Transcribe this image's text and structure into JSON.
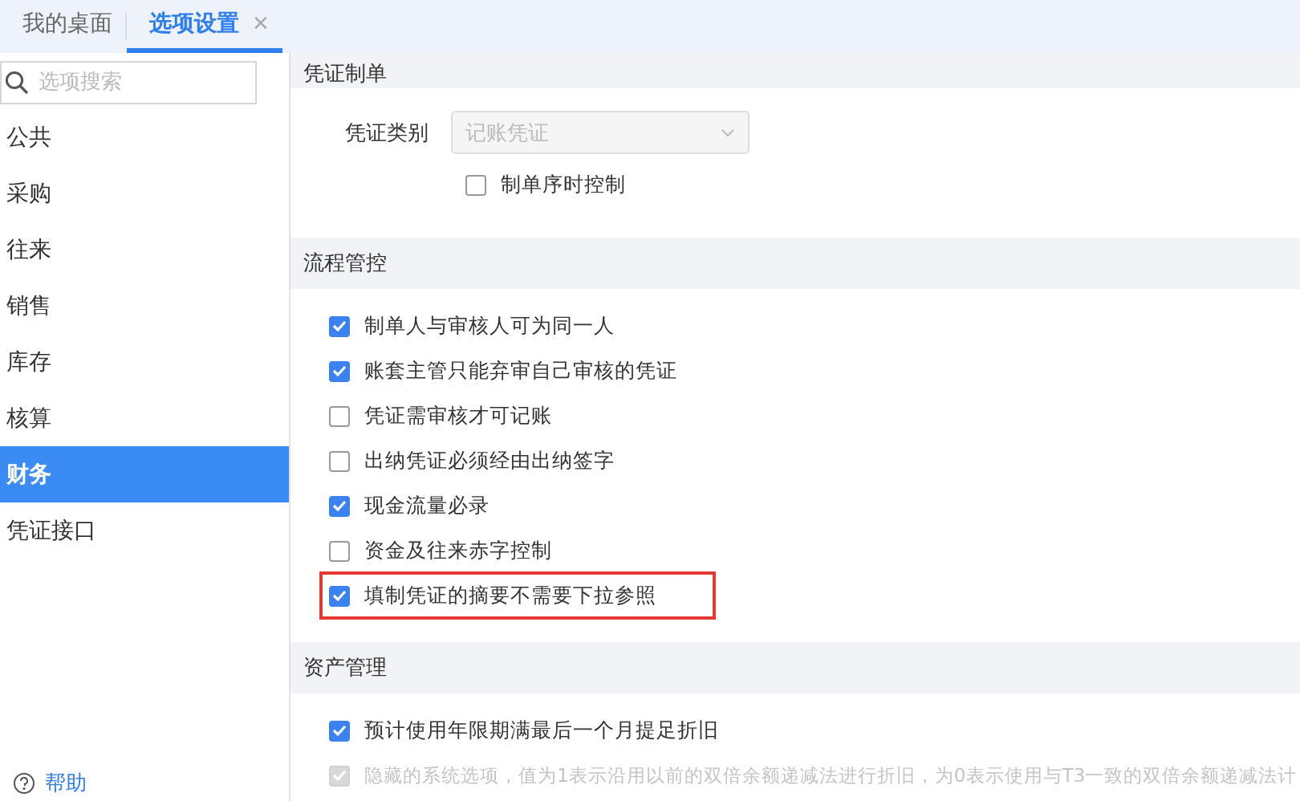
{
  "tabs": [
    {
      "label": "我的桌面",
      "selected": false
    },
    {
      "label": "选项设置",
      "selected": true,
      "close": "✕"
    }
  ],
  "sidebar": {
    "search": {
      "placeholder": "选项搜索"
    },
    "items": [
      {
        "label": "公共",
        "selected": false
      },
      {
        "label": "采购",
        "selected": false
      },
      {
        "label": "往来",
        "selected": false
      },
      {
        "label": "销售",
        "selected": false
      },
      {
        "label": "库存",
        "selected": false
      },
      {
        "label": "核算",
        "selected": false
      },
      {
        "label": "财务",
        "selected": true
      },
      {
        "label": "凭证接口",
        "selected": false
      }
    ],
    "help": "帮助"
  },
  "sections": [
    {
      "title": "凭证制单",
      "field": {
        "label": "凭证类别",
        "value": "记账凭证"
      },
      "options": [
        {
          "label": "制单序时控制",
          "checked": false,
          "disabled": false,
          "highlighted": false
        }
      ]
    },
    {
      "title": "流程管控",
      "options": [
        {
          "label": "制单人与审核人可为同一人",
          "checked": true,
          "disabled": false,
          "highlighted": false
        },
        {
          "label": "账套主管只能弃审自己审核的凭证",
          "checked": true,
          "disabled": false,
          "highlighted": false
        },
        {
          "label": "凭证需审核才可记账",
          "checked": false,
          "disabled": false,
          "highlighted": false
        },
        {
          "label": "出纳凭证必须经由出纳签字",
          "checked": false,
          "disabled": false,
          "highlighted": false
        },
        {
          "label": "现金流量必录",
          "checked": true,
          "disabled": false,
          "highlighted": false
        },
        {
          "label": "资金及往来赤字控制",
          "checked": false,
          "disabled": false,
          "highlighted": false
        },
        {
          "label": "填制凭证的摘要不需要下拉参照",
          "checked": true,
          "disabled": false,
          "highlighted": true
        }
      ]
    },
    {
      "title": "资产管理",
      "options": [
        {
          "label": "预计使用年限期满最后一个月提足折旧",
          "checked": true,
          "disabled": false,
          "highlighted": false
        },
        {
          "label": "隐藏的系统选项，值为1表示沿用以前的双倍余额递减法进行折旧，为0表示使用与T3一致的双倍余额递减法计",
          "checked": true,
          "disabled": true,
          "highlighted": false
        }
      ]
    }
  ]
}
